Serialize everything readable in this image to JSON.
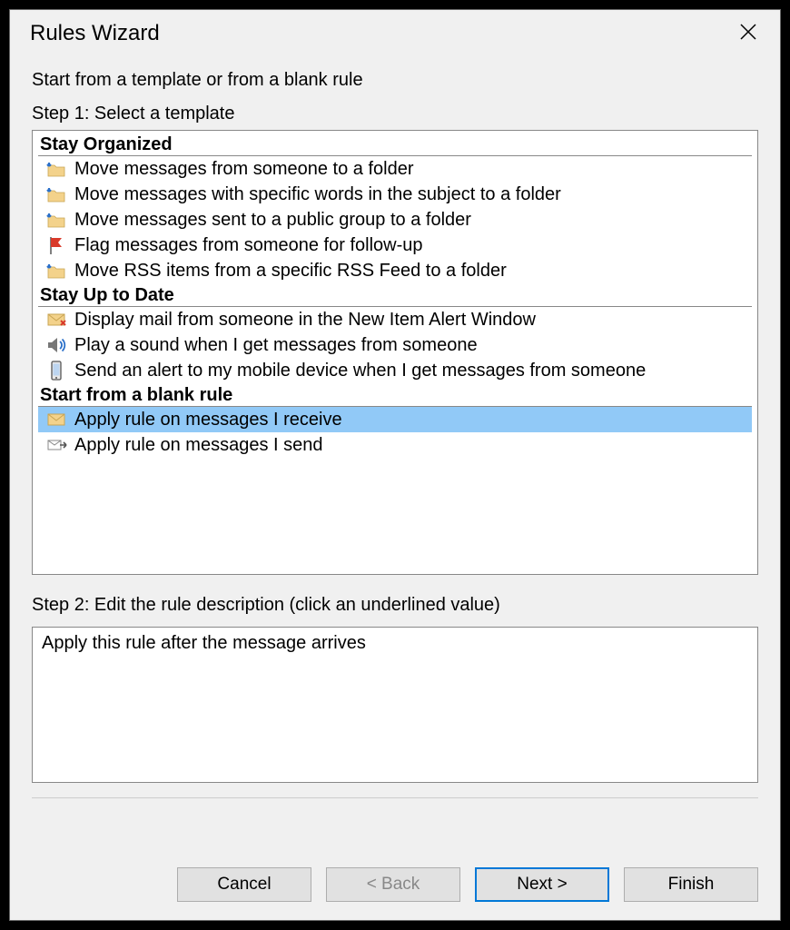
{
  "title": "Rules Wizard",
  "heading": "Start from a template or from a blank rule",
  "step1_label": "Step 1: Select a template",
  "groups": [
    {
      "title": "Stay Organized",
      "items": [
        {
          "icon": "folder-move",
          "label": "Move messages from someone to a folder"
        },
        {
          "icon": "folder-move",
          "label": "Move messages with specific words in the subject to a folder"
        },
        {
          "icon": "folder-move",
          "label": "Move messages sent to a public group to a folder"
        },
        {
          "icon": "flag",
          "label": "Flag messages from someone for follow-up"
        },
        {
          "icon": "folder-move",
          "label": "Move RSS items from a specific RSS Feed to a folder"
        }
      ]
    },
    {
      "title": "Stay Up to Date",
      "items": [
        {
          "icon": "mail-alert",
          "label": "Display mail from someone in the New Item Alert Window"
        },
        {
          "icon": "sound",
          "label": "Play a sound when I get messages from someone"
        },
        {
          "icon": "mobile",
          "label": "Send an alert to my mobile device when I get messages from someone"
        }
      ]
    },
    {
      "title": "Start from a blank rule",
      "items": [
        {
          "icon": "envelope",
          "label": "Apply rule on messages I receive",
          "selected": true
        },
        {
          "icon": "send",
          "label": "Apply rule on messages I send"
        }
      ]
    }
  ],
  "step2_label": "Step 2: Edit the rule description (click an underlined value)",
  "step2_text": "Apply this rule after the message arrives",
  "buttons": {
    "cancel": "Cancel",
    "back": "< Back",
    "next": "Next >",
    "finish": "Finish"
  }
}
